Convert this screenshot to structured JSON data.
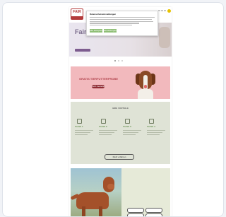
{
  "site": {
    "logo_text": "FAIR",
    "hero": {
      "title": "Fair",
      "subtitle": "",
      "button": ""
    },
    "consent": {
      "title": "Datenschutzeinstellungen",
      "accept_label": "Alle akzeptieren",
      "settings_label": "Einstellungen"
    },
    "promo": {
      "kicker": "",
      "title": "GRATIS TIERFUTTERPROBE",
      "button": "Jetzt bestellen"
    },
    "benefits": {
      "title": "IHRE VORTEILE",
      "items": [
        {
          "label": "Vorteil 1",
          "icon": "award-icon"
        },
        {
          "label": "Vorteil 2",
          "icon": "leaf-icon"
        },
        {
          "label": "Vorteil 3",
          "icon": "paw-icon"
        },
        {
          "label": "Vorteil 4",
          "icon": "heart-icon"
        }
      ],
      "button": "Mehr erfahren"
    },
    "ad": {
      "title": "",
      "button_1": "",
      "button_2": ""
    }
  },
  "colors": {
    "accent": "#8fbf76",
    "promo_bg": "#f2b9bd",
    "promo_text": "#b1414b",
    "benefits_bg": "#dfe3d6",
    "hero_purple": "#7d5c8f"
  }
}
